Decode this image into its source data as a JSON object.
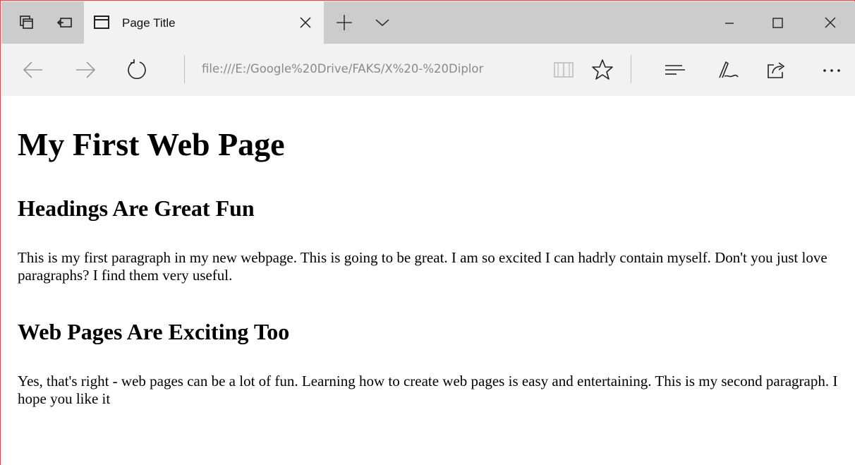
{
  "browser": {
    "tab": {
      "title": "Page Title"
    },
    "address_bar": {
      "url": "file:///E:/Google%20Drive/FAKS/X%20-%20Diplor"
    },
    "icons": {
      "tab_manager": "tab-manager-icon",
      "set_aside_tabs": "set-aside-tabs-icon",
      "tab_page": "page-icon",
      "close_tab": "close-icon",
      "new_tab": "plus-icon",
      "tab_preview": "chevron-down-icon",
      "minimize": "minimize-icon",
      "maximize": "maximize-icon",
      "close_window": "close-icon",
      "back": "back-arrow-icon",
      "forward": "forward-arrow-icon",
      "refresh": "refresh-icon",
      "reading_view": "book-icon",
      "favorite": "star-icon",
      "hub": "hub-icon",
      "web_note": "pen-icon",
      "share": "share-icon",
      "more": "more-icon"
    },
    "colors": {
      "tabstrip": "#cccccc",
      "toolbar": "#f2f2f2",
      "window_border": "#c75050"
    }
  },
  "page": {
    "heading": "My First Web Page",
    "sections": [
      {
        "heading": "Headings Are Great Fun",
        "paragraph": "This is my first paragraph in my new webpage. This is going to be great. I am so excited I can hadrly contain myself. Don't you just love paragraphs? I find them very useful."
      },
      {
        "heading": "Web Pages Are Exciting Too",
        "paragraph": "Yes, that's right - web pages can be a lot of fun. Learning how to create web pages is easy and entertaining. This is my second paragraph. I hope you like it"
      }
    ]
  }
}
